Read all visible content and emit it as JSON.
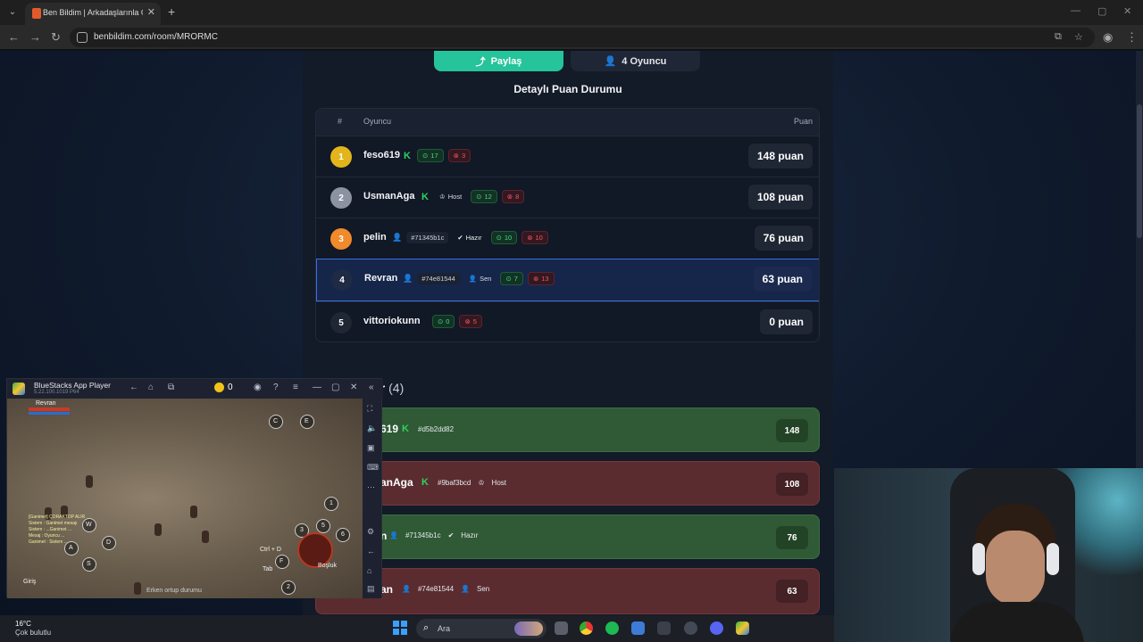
{
  "browser": {
    "tab_title": "Ben Bildim | Arkadaşlarınla Onl",
    "url": "benbildim.com/room/MRORMC"
  },
  "top_buttons": {
    "share_label": "Paylaş",
    "players_label": "4 Oyuncu"
  },
  "scoreboard": {
    "title": "Detaylı Puan Durumu",
    "col_rank": "#",
    "col_player": "Oyuncu",
    "col_score": "Puan",
    "rows": [
      {
        "rank": "1",
        "name": "feso619",
        "correct": "17",
        "wrong": "3",
        "score": "148 puan"
      },
      {
        "rank": "2",
        "name": "UsmanAga",
        "host": "Host",
        "correct": "12",
        "wrong": "8",
        "score": "108 puan"
      },
      {
        "rank": "3",
        "name": "pelin",
        "id": "#71345b1c",
        "ready": "Hazır",
        "correct": "10",
        "wrong": "10",
        "score": "76 puan"
      },
      {
        "rank": "4",
        "name": "Revran",
        "id": "#74e81544",
        "you": "Sen",
        "correct": "7",
        "wrong": "13",
        "score": "63 puan"
      },
      {
        "rank": "5",
        "name": "vittoriokunn",
        "correct": "0",
        "wrong": "5",
        "score": "0 puan"
      }
    ]
  },
  "players_section": {
    "title": "ar",
    "count": "(4)",
    "rows": [
      {
        "name": "619",
        "id": "#d5b2dd82",
        "score": "148"
      },
      {
        "name": "anAga",
        "id": "#9baf3bcd",
        "host": "Host",
        "score": "108"
      },
      {
        "name": "n",
        "id": "#71345b1c",
        "ready": "Hazır",
        "score": "76"
      },
      {
        "name": "an",
        "id": "#74e81544",
        "you": "Sen",
        "score": "63"
      }
    ]
  },
  "bluestacks": {
    "title": "BlueStacks App Player",
    "version": "5.22.100.1019 P64",
    "coins": "0",
    "hud": {
      "player_name": "Revran",
      "bottom_text": "Erken ortup durumu",
      "space_label": "Boşluk",
      "ctrl_d": "Ctrl + D",
      "tab": "Tab",
      "giris": "Giriş"
    },
    "chat_lines": [
      "[Ganimet] ÇORAKTOP ALIR",
      "Sistem : Ganimet mesajı",
      "Sistem : ...Ganimet ...",
      "Mesaj : Oyuncu ...",
      "Ganimet : Sistem ..."
    ],
    "key_labels": [
      "A",
      "D",
      "W",
      "S",
      "E",
      "C",
      "F",
      "1",
      "2",
      "3",
      "4",
      "5",
      "6"
    ]
  },
  "taskbar": {
    "temperature": "16°C",
    "weather": "Çok bulutlu",
    "search_placeholder": "Ara"
  }
}
